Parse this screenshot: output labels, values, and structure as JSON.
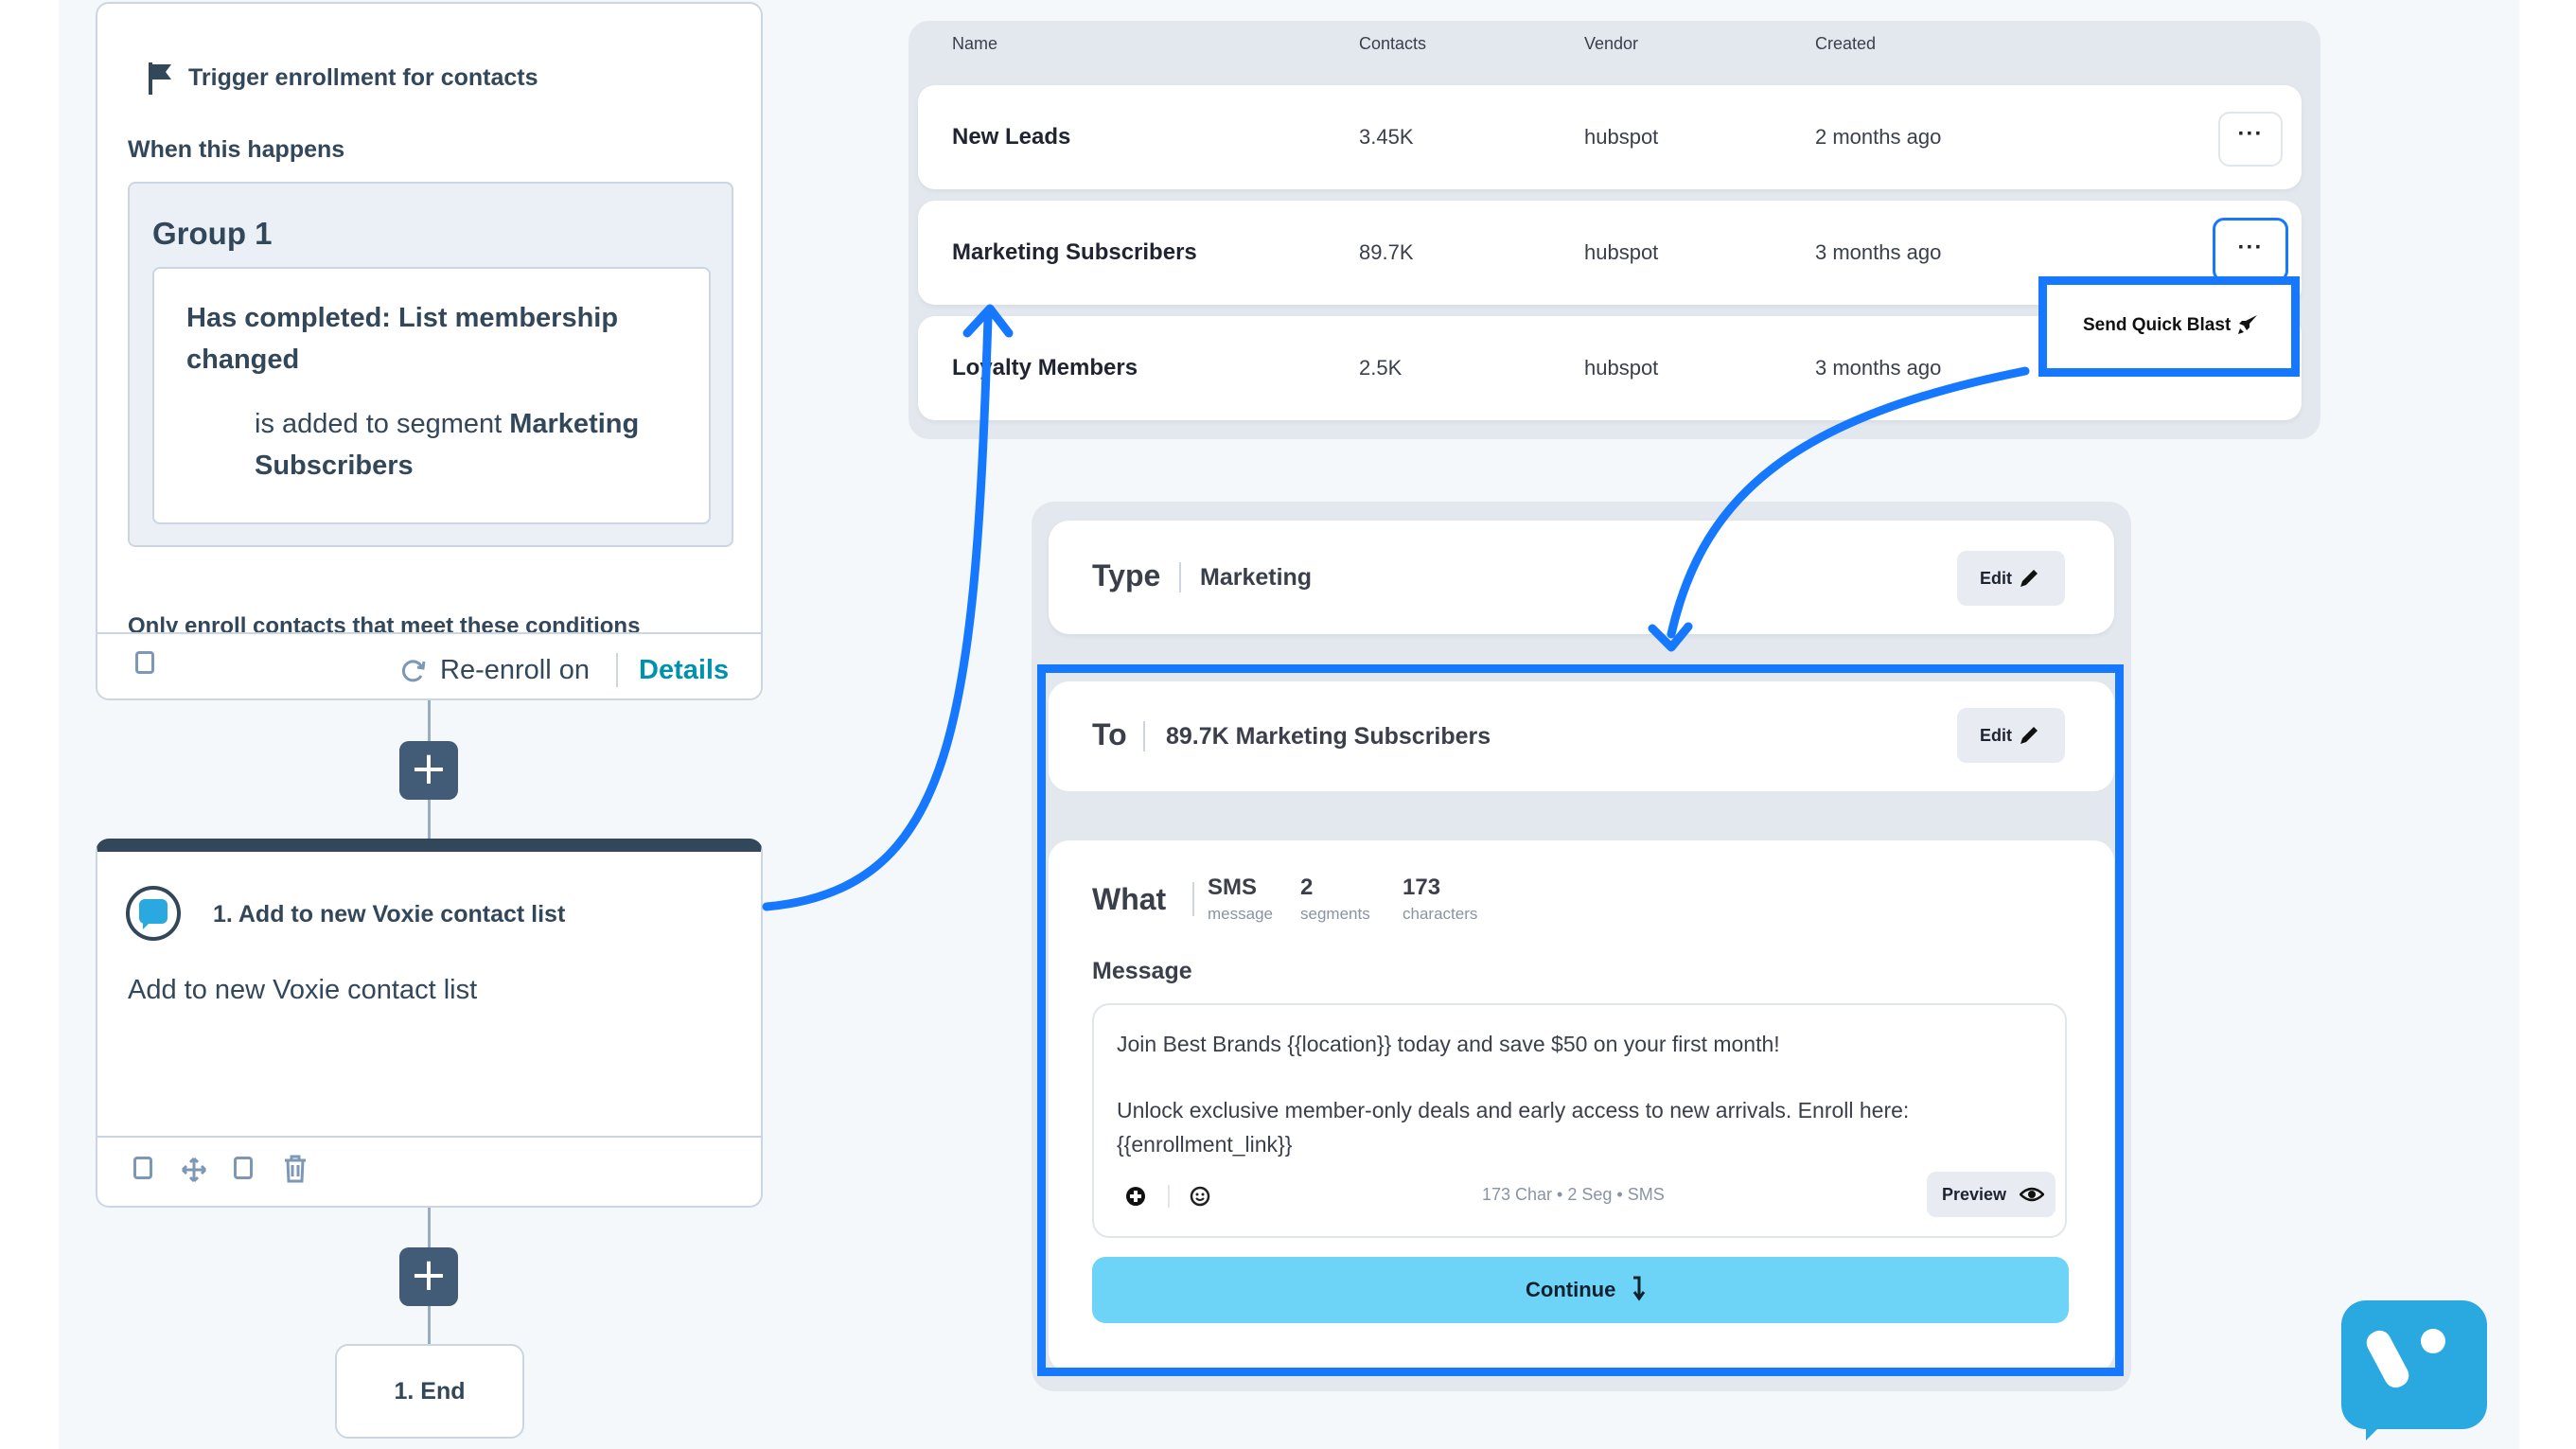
{
  "trigger": {
    "title": "Trigger enrollment for contacts",
    "when_label": "When this happens",
    "group_title": "Group 1",
    "condition_line1": "Has completed: List membership",
    "condition_line2": "changed",
    "segment_prefix": "is added to segment",
    "segment_name_1": "Marketing",
    "segment_name_2": "Subscribers",
    "only_enroll": "Only enroll contacts that meet these conditions",
    "reenroll": "Re-enroll on",
    "details": "Details"
  },
  "action": {
    "title": "1. Add to new Voxie contact list",
    "description": "Add to new Voxie contact list"
  },
  "end": {
    "label": "1. End"
  },
  "plus_label": "+",
  "lists_table": {
    "columns": [
      "Name",
      "Contacts",
      "Vendor",
      "Created"
    ],
    "rows": [
      {
        "name": "New Leads",
        "contacts": "3.45K",
        "vendor": "hubspot",
        "created": "2 months ago"
      },
      {
        "name": "Marketing Subscribers",
        "contacts": "89.7K",
        "vendor": "hubspot",
        "created": "3 months ago"
      },
      {
        "name": "Loyalty Members",
        "contacts": "2.5K",
        "vendor": "hubspot",
        "created": "3 months ago"
      }
    ],
    "more_label": "···",
    "quick_blast": "Send Quick Blast"
  },
  "blast": {
    "type_label": "Type",
    "type_value": "Marketing",
    "to_label": "To",
    "to_value": "89.7K Marketing Subscribers",
    "edit_label": "Edit",
    "what_label": "What",
    "stats": [
      {
        "value": "SMS",
        "caption": "message"
      },
      {
        "value": "2",
        "caption": "segments"
      },
      {
        "value": "173",
        "caption": "characters"
      }
    ],
    "message_label": "Message",
    "message_line1": "Join Best Brands {{location}} today and save $50 on your first month!",
    "message_line2": "Unlock exclusive member-only deals and early access to new arrivals. Enroll here:",
    "message_line3": "{{enrollment_link}}",
    "counter": "173 Char • 2 Seg • SMS",
    "preview_label": "Preview",
    "continue_label": "Continue"
  },
  "colors": {
    "accent_blue": "#1677ff",
    "continue_bg": "#6dd3f7",
    "workflow_dark": "#425b76",
    "voxie_blue": "#2aa8e0"
  }
}
